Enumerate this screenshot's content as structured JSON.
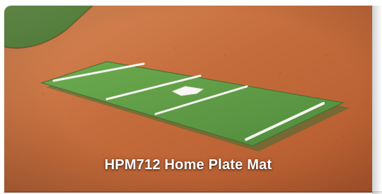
{
  "image": {
    "caption": "HPM712 Home Plate Mat"
  },
  "colors": {
    "dirt_light": "#d07a45",
    "dirt_dark": "#b85b2d",
    "grass": "#4d7a36",
    "mat_green": "#5f9b45",
    "mat_shadow": "#3f6d32",
    "line_white": "#f4f6ef"
  }
}
